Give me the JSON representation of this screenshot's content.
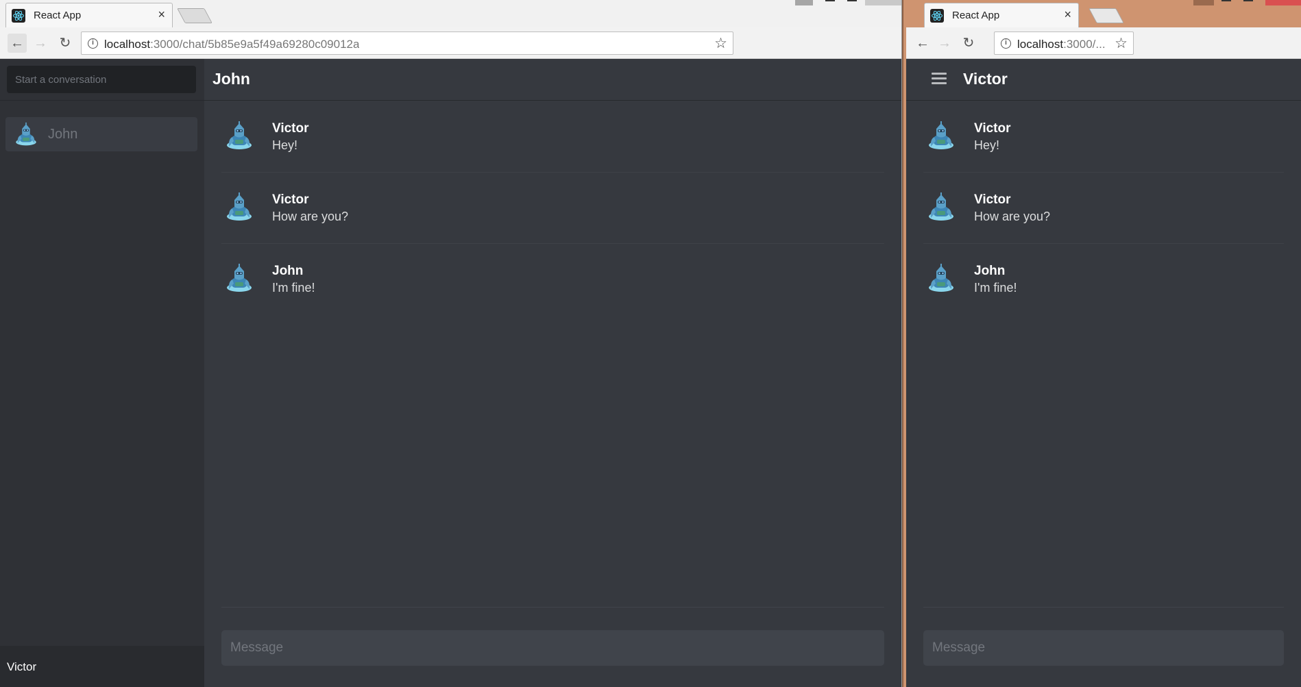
{
  "left_window": {
    "tab": {
      "title": "React App",
      "close": "×"
    },
    "toolbar": {
      "back": "←",
      "forward": "→",
      "reload": "↻",
      "url_host": "localhost",
      "url_path": ":3000/chat/5b85e9a5f49a69280c09012a",
      "star": "☆"
    },
    "sidebar": {
      "search_placeholder": "Start a conversation",
      "conversations": [
        {
          "name": "John",
          "avatar": "robot-avatar"
        }
      ],
      "current_user": "Victor"
    },
    "chat": {
      "title": "John",
      "messages": [
        {
          "author": "Victor",
          "text": "Hey!"
        },
        {
          "author": "Victor",
          "text": "How are you?"
        },
        {
          "author": "John",
          "text": "I'm fine!"
        }
      ],
      "composer_placeholder": "Message"
    }
  },
  "right_window": {
    "tab": {
      "title": "React App",
      "close": "×"
    },
    "toolbar": {
      "back": "←",
      "forward": "→",
      "reload": "↻",
      "url_host": "localhost",
      "url_path": ":3000/...",
      "star": "☆"
    },
    "chat": {
      "title": "Victor",
      "messages": [
        {
          "author": "Victor",
          "text": "Hey!"
        },
        {
          "author": "Victor",
          "text": "How are you?"
        },
        {
          "author": "John",
          "text": "I'm fine!"
        }
      ],
      "composer_placeholder": "Message"
    }
  },
  "colors": {
    "app_bg": "#36393f",
    "sidebar_bg": "#2f3136",
    "desktop_bg": "#cf9470",
    "react_logo": "#61dafb"
  }
}
